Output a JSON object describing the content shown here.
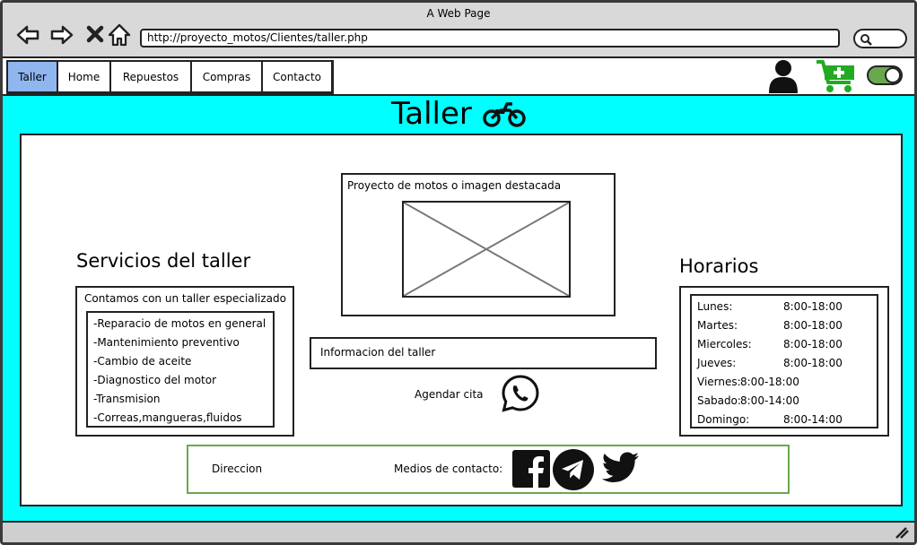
{
  "window": {
    "title": "A Web Page"
  },
  "browser": {
    "url": "http://proyecto_motos/Clientes/taller.php"
  },
  "nav": {
    "tabs": [
      {
        "label": "Taller",
        "active": true
      },
      {
        "label": "Home"
      },
      {
        "label": "Repuestos"
      },
      {
        "label": "Compras"
      },
      {
        "label": "Contacto"
      }
    ],
    "icons": [
      "user-icon",
      "cart-add-icon",
      "toggle-switch-icon"
    ]
  },
  "page": {
    "title": "Taller",
    "title_icon": "motorcycle-icon",
    "background": "#00ffff"
  },
  "featured": {
    "caption": "Proyecto de motos o imagen destacada"
  },
  "servicios": {
    "title": "Servicios del taller",
    "lead": "Contamos con un taller especializado",
    "items": [
      "-Reparacio de motos en general",
      "-Mantenimiento preventivo",
      "-Cambio de aceite",
      "-Diagnostico del motor",
      "-Transmision",
      "-Correas,mangueras,fluidos"
    ]
  },
  "info": {
    "label": "Informacion del taller"
  },
  "cita": {
    "label": "Agendar cita",
    "icon": "whatsapp-icon"
  },
  "horarios": {
    "title": "Horarios",
    "rows": [
      {
        "day": "Lunes:",
        "hours": "8:00-18:00"
      },
      {
        "day": "Martes:",
        "hours": "8:00-18:00"
      },
      {
        "day": "Miercoles:",
        "hours": "8:00-18:00"
      },
      {
        "day": "Jueves:",
        "hours": "8:00-18:00"
      },
      {
        "day": "Viernes:",
        "hours": "8:00-18:00"
      },
      {
        "day": "Sabado:",
        "hours": "8:00-14:00"
      },
      {
        "day": "Domingo:",
        "hours": "8:00-14:00"
      }
    ]
  },
  "contact": {
    "direccion": "Direccion",
    "medios": "Medios de contacto:",
    "icons": [
      "facebook-icon",
      "telegram-icon",
      "twitter-icon"
    ],
    "border_color": "#6aa84f"
  },
  "colors": {
    "active_tab": "#8fb6ee",
    "cart_green": "#22aa22",
    "toggle_green": "#6aa84f"
  }
}
